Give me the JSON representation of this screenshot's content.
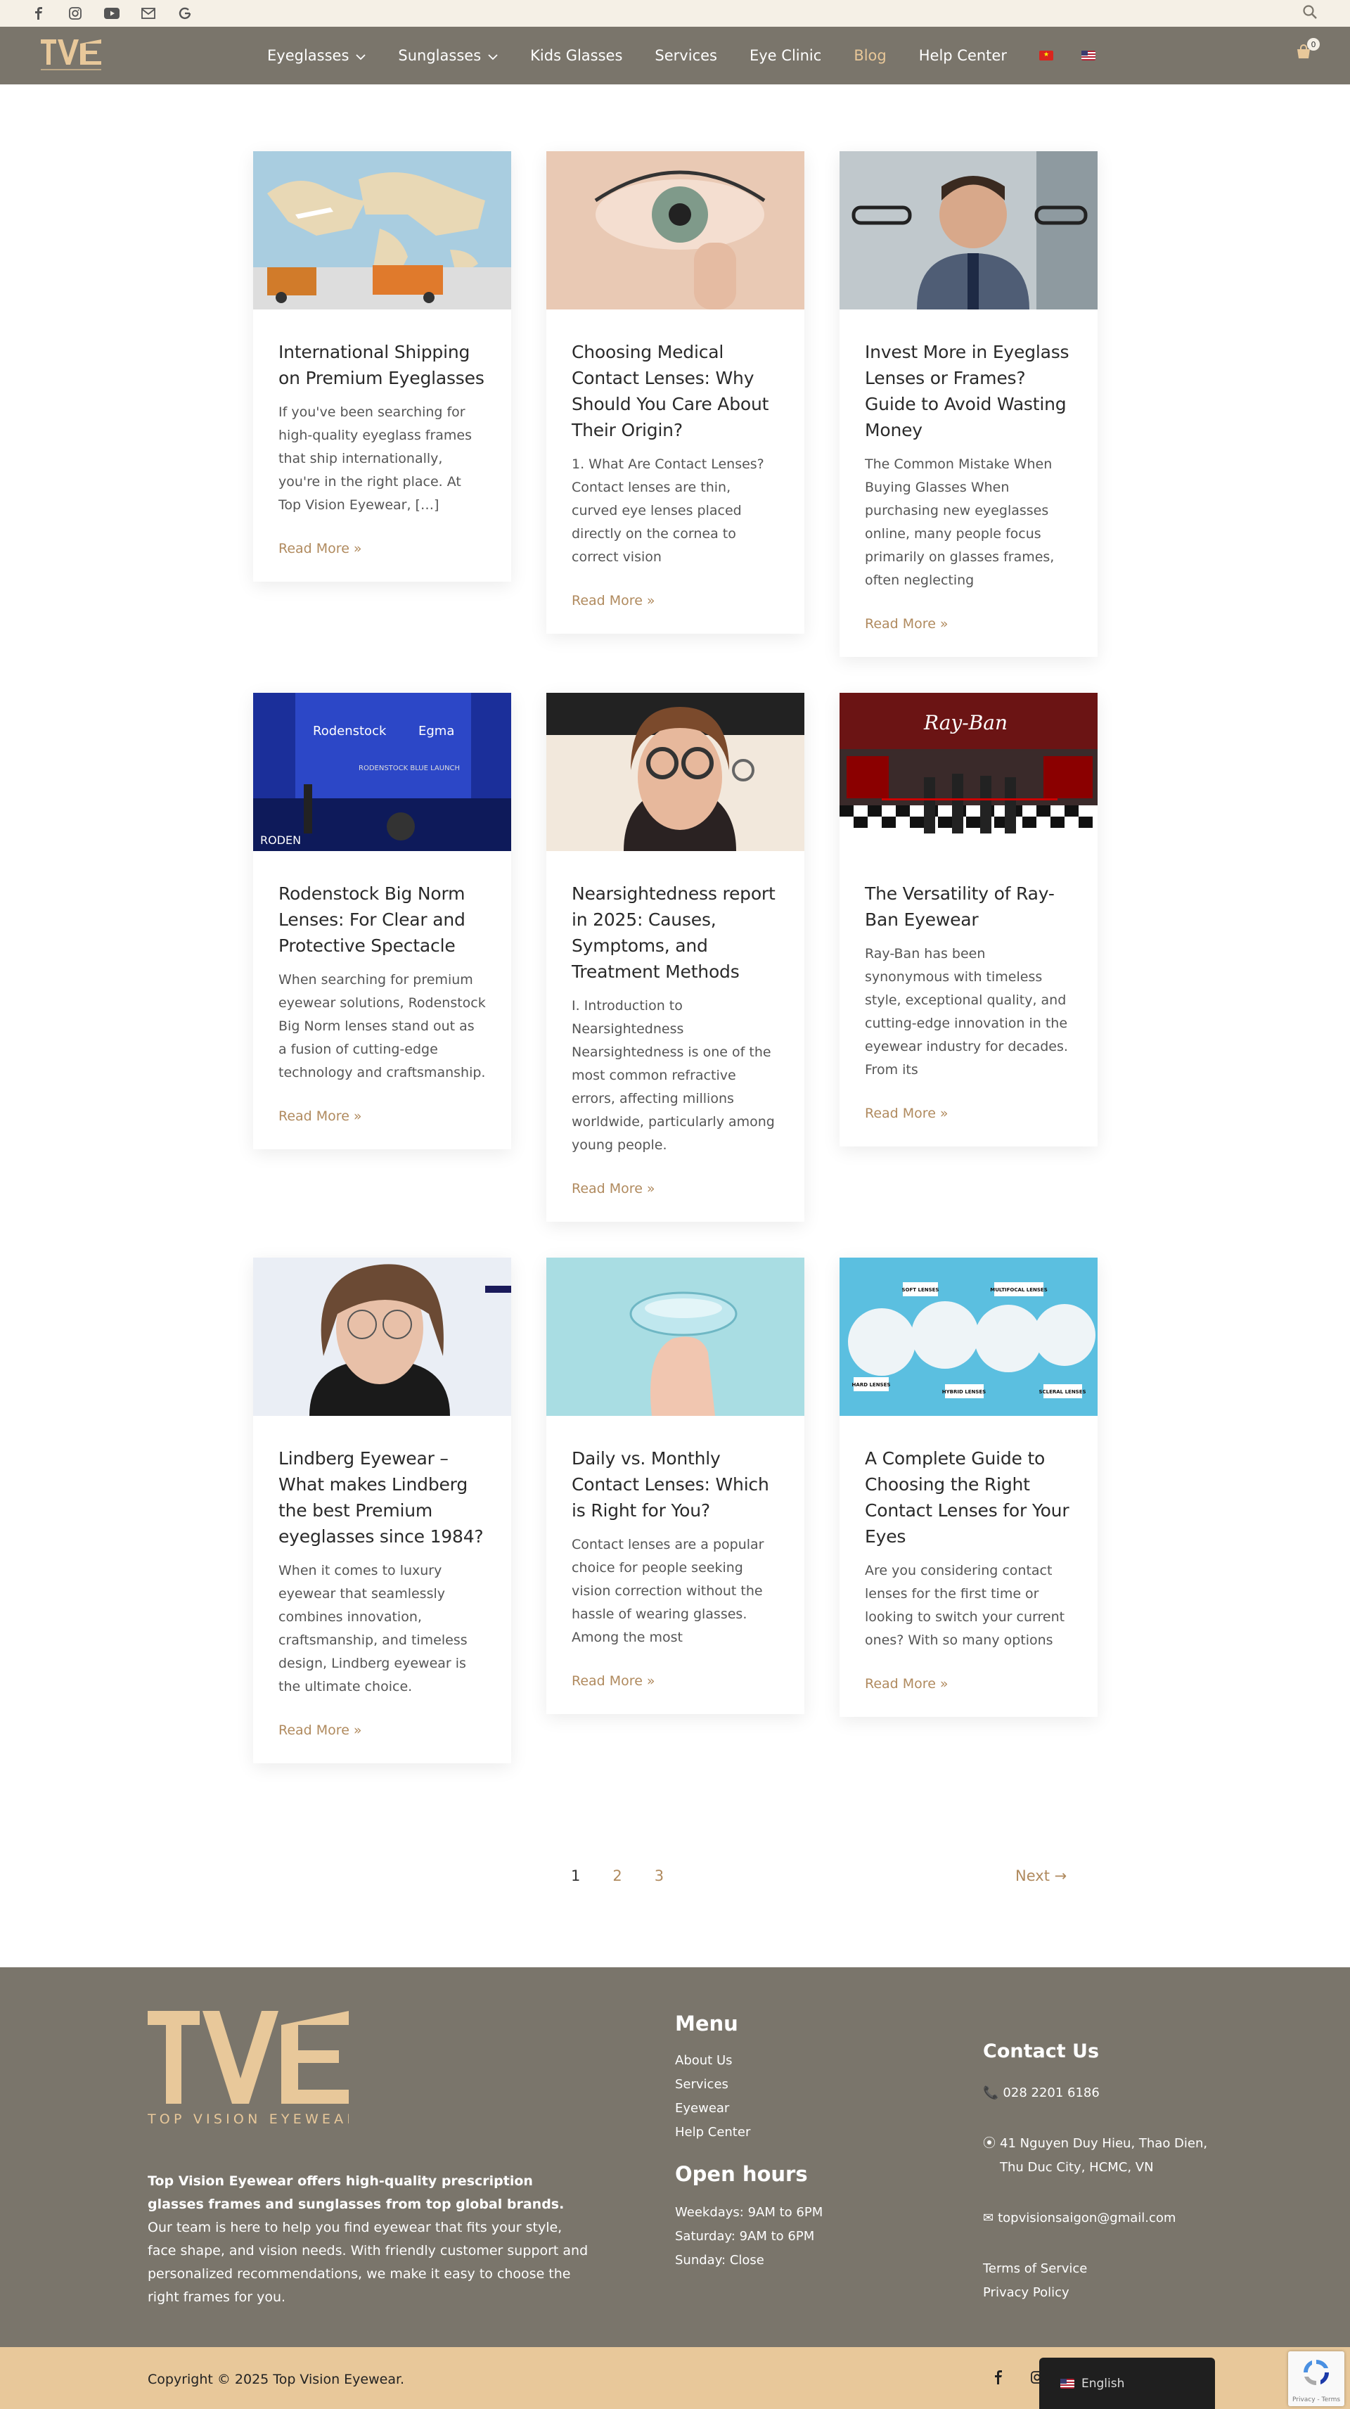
{
  "topbar": {
    "social_icons": [
      "facebook-icon",
      "instagram-icon",
      "youtube-icon",
      "mail-icon",
      "google-icon"
    ]
  },
  "nav": {
    "items": [
      {
        "label": "Eyeglasses",
        "dropdown": true
      },
      {
        "label": "Sunglasses",
        "dropdown": true
      },
      {
        "label": "Kids Glasses",
        "dropdown": false
      },
      {
        "label": "Services",
        "dropdown": false
      },
      {
        "label": "Eye Clinic",
        "dropdown": false
      },
      {
        "label": "Blog",
        "dropdown": false,
        "active": true
      },
      {
        "label": "Help Center",
        "dropdown": false
      }
    ],
    "cart_count": "0"
  },
  "posts": [
    {
      "title": "International Shipping on Premium Eyeglasses",
      "excerpt": "If you've been searching for high-quality eyeglass frames that ship internationally, you're in the right place. At Top Vision Eyewear, […]",
      "more": "Read More »"
    },
    {
      "title": "Choosing Medical Contact Lenses: Why Should You Care About Their Origin?",
      "excerpt": "1. What Are Contact Lenses? Contact lenses are thin, curved eye lenses placed directly on the cornea to correct vision",
      "more": "Read More »"
    },
    {
      "title": "Invest More in Eyeglass Lenses or Frames? Guide to Avoid Wasting Money",
      "excerpt": "The Common Mistake When Buying Glasses When purchasing new eyeglasses online, many people focus primarily on glasses frames, often neglecting",
      "more": "Read More »"
    },
    {
      "title": "Rodenstock Big Norm Lenses: For Clear and Protective Spectacle",
      "excerpt": "When searching for premium eyewear solutions, Rodenstock Big Norm lenses stand out as a fusion of cutting-edge technology and craftsmanship.",
      "more": "Read More »"
    },
    {
      "title": "Nearsightedness report in 2025: Causes, Symptoms, and Treatment Methods",
      "excerpt": "I. Introduction to Nearsightedness Nearsightedness is one of the most common refractive errors, affecting millions worldwide, particularly among young people.",
      "more": "Read More »"
    },
    {
      "title": "The Versatility of Ray-Ban Eyewear",
      "excerpt": "Ray-Ban has been synonymous with timeless style, exceptional quality, and cutting-edge innovation in the eyewear industry for decades. From its",
      "more": "Read More »"
    },
    {
      "title": "Lindberg Eyewear – What makes Lindberg the best Premium eyeglasses since 1984?",
      "excerpt": "When it comes to luxury eyewear that seamlessly combines innovation, craftsmanship, and timeless design, Lindberg eyewear is the ultimate choice.",
      "more": "Read More »"
    },
    {
      "title": "Daily vs. Monthly Contact Lenses: Which is Right for You?",
      "excerpt": "Contact lenses are a popular choice for people seeking vision correction without the hassle of wearing glasses. Among the most",
      "more": "Read More »"
    },
    {
      "title": "A Complete Guide to Choosing the Right Contact Lenses for Your Eyes",
      "excerpt": "Are you considering contact lenses for the first time or looking to switch your current ones? With so many options",
      "more": "Read More »"
    }
  ],
  "image_labels": {
    "rodenstock_brand": "Rodenstock",
    "rodenstock_banner": "RODENSTOCK BLUE LAUNCH",
    "rodenstock_corner": "RODEN",
    "egma": "Egma",
    "rayban": "Ray-Ban",
    "lens_types": [
      "SOFT LENSES",
      "MULTIFOCAL LENSES",
      "HARD LENSES",
      "HYBRID LENSES",
      "SCLERAL LENSES"
    ]
  },
  "pagination": {
    "pages": [
      "1",
      "2",
      "3"
    ],
    "next": "Next →"
  },
  "footer": {
    "logo_letters": "TVE",
    "logo_text": "TOP VISION EYEWEAR",
    "desc_bold": "Top Vision Eyewear offers high-quality prescription glasses frames and sunglasses from top global brands.",
    "desc_rest": " Our team is here to help you find eyewear that fits your style, face shape, and vision needs. With friendly customer support and personalized recommendations, we make it easy to choose the right frames for you.",
    "menu_title": "Menu",
    "menu": [
      "About Us",
      "Services",
      "Eyewear",
      "Help Center"
    ],
    "hours_title": "Open hours",
    "hours": [
      "Weekdays: 9AM to 6PM",
      "Saturday: 9AM to 6PM",
      "Sunday: Close"
    ],
    "contact_title": "Contact Us",
    "phone": "028 2201 6186",
    "address": "41 Nguyen Duy Hieu, Thao Dien, Thu Duc City, HCMC, VN",
    "email": "topvisionsaigon@gmail.com",
    "links": [
      "Terms of Service",
      "Privacy Policy"
    ]
  },
  "bottom": {
    "copyright": "Copyright © 2025 Top Vision Eyewear.",
    "language": "English",
    "recaptcha": "Privacy - Terms"
  },
  "colors": {
    "nav_bg": "#7a756b",
    "accent": "#b08a5e",
    "gold": "#e8c89a",
    "topbar": "#f5f0e6"
  }
}
